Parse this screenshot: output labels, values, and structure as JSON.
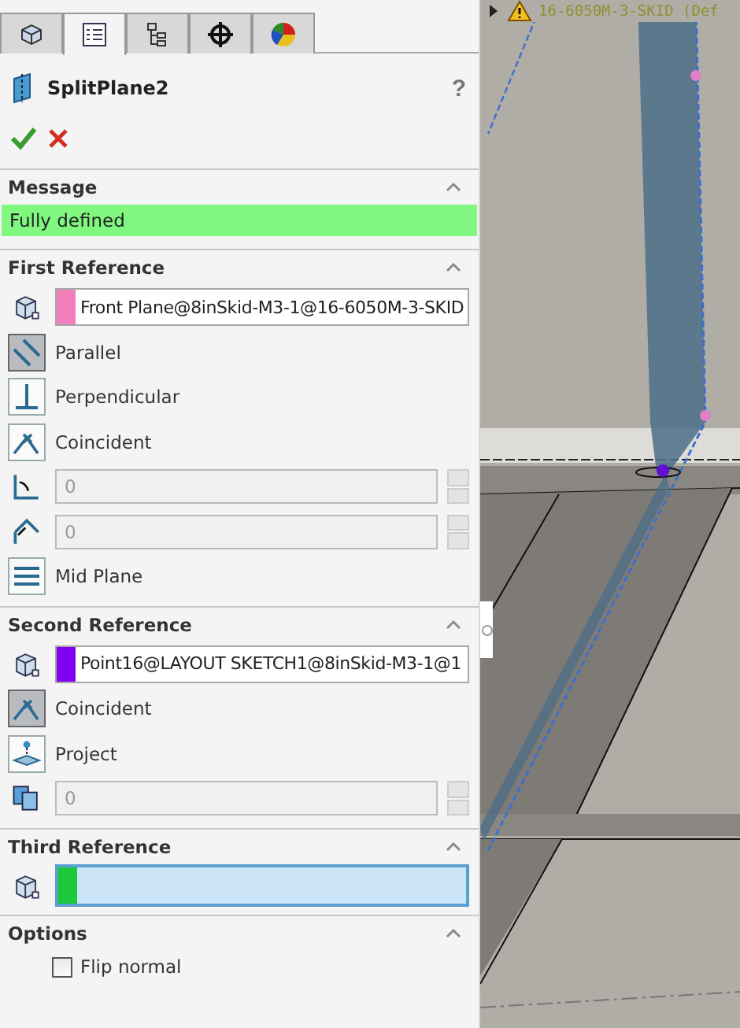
{
  "tabs": [
    {
      "kind": "part",
      "selected": false
    },
    {
      "kind": "property",
      "selected": true
    },
    {
      "kind": "config",
      "selected": false
    },
    {
      "kind": "target",
      "selected": false
    },
    {
      "kind": "appearance",
      "selected": false
    }
  ],
  "feature": {
    "title": "SplitPlane2",
    "help": "?"
  },
  "message": {
    "title": "Message",
    "text": "Fully defined"
  },
  "sections": [
    {
      "title": "First Reference",
      "items": [
        {
          "kind": "field",
          "color": "#f27fbb",
          "value": "Front Plane@8inSkid-M3-1@16-6050M-3-SKID",
          "active": false
        },
        {
          "kind": "toggle",
          "label": "Parallel",
          "selected": true
        },
        {
          "kind": "toggle",
          "label": "Perpendicular",
          "selected": false
        },
        {
          "kind": "toggle",
          "label": "Coincident",
          "selected": false
        },
        {
          "kind": "number",
          "value": "0",
          "disabled": true
        },
        {
          "kind": "number",
          "value": "0",
          "disabled": true
        },
        {
          "kind": "toggle",
          "label": "Mid Plane",
          "selected": false
        }
      ]
    },
    {
      "title": "Second Reference",
      "items": [
        {
          "kind": "field",
          "color": "#8000f0",
          "value": "Point16@LAYOUT SKETCH1@8inSkid-M3-1@1",
          "active": false
        },
        {
          "kind": "toggle",
          "label": "Coincident",
          "selected": true
        },
        {
          "kind": "toggle",
          "label": "Project",
          "selected": false
        },
        {
          "kind": "number",
          "value": "0",
          "disabled": true
        }
      ]
    },
    {
      "title": "Third Reference",
      "items": [
        {
          "kind": "field",
          "color": "#1ec83c",
          "value": "",
          "active": true
        }
      ]
    }
  ],
  "options": {
    "title": "Options",
    "items": [
      {
        "label": "Flip normal",
        "checked": false
      }
    ]
  },
  "viewport": {
    "tree_label": "16-6050M-3-SKID (Def"
  }
}
